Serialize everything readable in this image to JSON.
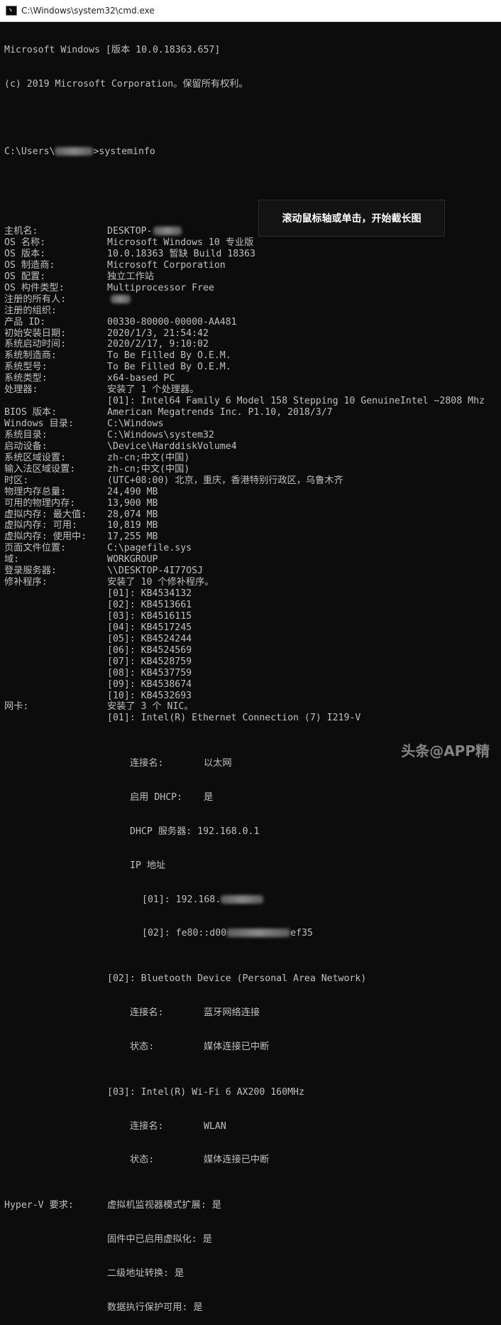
{
  "window": {
    "title": "C:\\Windows\\system32\\cmd.exe"
  },
  "header": {
    "line1": "Microsoft Windows [版本 10.0.18363.657]",
    "line2": "(c) 2019 Microsoft Corporation。保留所有权利。",
    "prompt_prefix": "C:\\Users\\",
    "prompt_suffix": ">systeminfo"
  },
  "rows": [
    {
      "k": "主机名:",
      "v": "DESKTOP-"
    },
    {
      "k": "OS 名称:",
      "v": "Microsoft Windows 10 专业版"
    },
    {
      "k": "OS 版本:",
      "v": "10.0.18363 暂缺 Build 18363"
    },
    {
      "k": "OS 制造商:",
      "v": "Microsoft Corporation"
    },
    {
      "k": "OS 配置:",
      "v": "独立工作站"
    },
    {
      "k": "OS 构件类型:",
      "v": "Multiprocessor Free"
    },
    {
      "k": "注册的所有人:",
      "v": ""
    },
    {
      "k": "注册的组织:",
      "v": ""
    },
    {
      "k": "产品 ID:",
      "v": "00330-80000-00000-AA481"
    },
    {
      "k": "初始安装日期:",
      "v": "2020/1/3, 21:54:42"
    },
    {
      "k": "系统启动时间:",
      "v": "2020/2/17, 9:10:02"
    },
    {
      "k": "系统制造商:",
      "v": "To Be Filled By O.E.M."
    },
    {
      "k": "系统型号:",
      "v": "To Be Filled By O.E.M."
    },
    {
      "k": "系统类型:",
      "v": "x64-based PC"
    },
    {
      "k": "处理器:",
      "v": "安装了 1 个处理器。"
    },
    {
      "k": "",
      "v": "[01]: Intel64 Family 6 Model 158 Stepping 10 GenuineIntel ~2808 Mhz"
    },
    {
      "k": "BIOS 版本:",
      "v": "American Megatrends Inc. P1.10, 2018/3/7"
    },
    {
      "k": "Windows 目录:",
      "v": "C:\\Windows"
    },
    {
      "k": "系统目录:",
      "v": "C:\\Windows\\system32"
    },
    {
      "k": "启动设备:",
      "v": "\\Device\\HarddiskVolume4"
    },
    {
      "k": "系统区域设置:",
      "v": "zh-cn;中文(中国)"
    },
    {
      "k": "输入法区域设置:",
      "v": "zh-cn;中文(中国)"
    },
    {
      "k": "时区:",
      "v": "(UTC+08:00) 北京，重庆，香港特别行政区，乌鲁木齐"
    },
    {
      "k": "物理内存总量:",
      "v": "24,490 MB"
    },
    {
      "k": "可用的物理内存:",
      "v": "13,900 MB"
    },
    {
      "k": "虚拟内存: 最大值:",
      "v": "28,074 MB"
    },
    {
      "k": "虚拟内存: 可用:",
      "v": "10,819 MB"
    },
    {
      "k": "虚拟内存: 使用中:",
      "v": "17,255 MB"
    },
    {
      "k": "页面文件位置:",
      "v": "C:\\pagefile.sys"
    },
    {
      "k": "域:",
      "v": "WORKGROUP"
    },
    {
      "k": "登录服务器:",
      "v": "\\\\DESKTOP-4I77OSJ"
    },
    {
      "k": "修补程序:",
      "v": "安装了 10 个修补程序。"
    },
    {
      "k": "",
      "v": "[01]: KB4534132"
    },
    {
      "k": "",
      "v": "[02]: KB4513661"
    },
    {
      "k": "",
      "v": "[03]: KB4516115"
    },
    {
      "k": "",
      "v": "[04]: KB4517245"
    },
    {
      "k": "",
      "v": "[05]: KB4524244"
    },
    {
      "k": "",
      "v": "[06]: KB4524569"
    },
    {
      "k": "",
      "v": "[07]: KB4528759"
    },
    {
      "k": "",
      "v": "[08]: KB4537759"
    },
    {
      "k": "",
      "v": "[09]: KB4538674"
    },
    {
      "k": "",
      "v": "[10]: KB4532693"
    },
    {
      "k": "网卡:",
      "v": "安装了 3 个 NIC。"
    },
    {
      "k": "",
      "v": "[01]: Intel(R) Ethernet Connection (7) I219-V"
    }
  ],
  "nic1": {
    "conn_label": "连接名:",
    "conn_value": "以太网",
    "dhcp_label": "启用 DHCP:",
    "dhcp_value": "是",
    "server_label": "DHCP 服务器:",
    "server_value": "192.168.0.1",
    "ip_label": "IP 地址",
    "ip1": "[01]: 192.168.",
    "ip2_pre": "[02]: fe80::d00",
    "ip2_post": "ef35"
  },
  "nic2": {
    "title": "[02]: Bluetooth Device (Personal Area Network)",
    "conn_label": "连接名:",
    "conn_value": "蓝牙网络连接",
    "state_label": "状态:",
    "state_value": "媒体连接已中断"
  },
  "nic3": {
    "title": "[03]: Intel(R) Wi-Fi 6 AX200 160MHz",
    "conn_label": "连接名:",
    "conn_value": "WLAN",
    "state_label": "状态:",
    "state_value": "媒体连接已中断"
  },
  "hyperv": {
    "label": "Hyper-V 要求:",
    "l1": "虚拟机监视器模式扩展: 是",
    "l2": "固件中已启用虚拟化: 是",
    "l3": "二级地址转换: 是",
    "l4": "数据执行保护可用: 是"
  },
  "overlay": {
    "tip": "滚动鼠标轴或单击，开始截长图"
  },
  "watermark": {
    "text": "头条@APP精"
  }
}
